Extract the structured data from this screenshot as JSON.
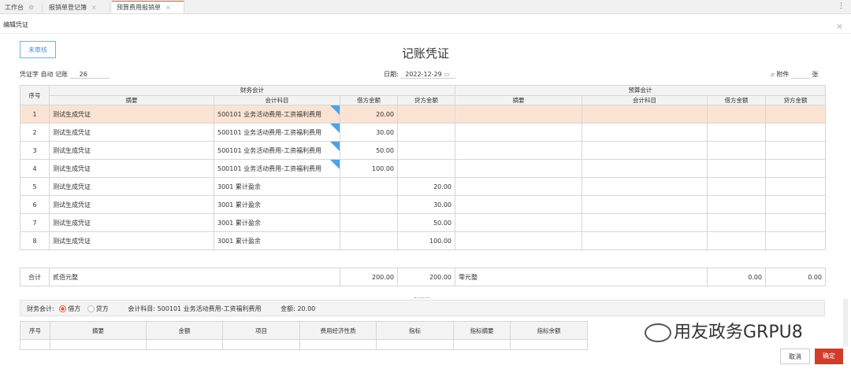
{
  "tabs": [
    {
      "label": "工作台"
    },
    {
      "label": "报销单登记簿"
    },
    {
      "label": "预算费用报销单"
    }
  ],
  "subtitle": "编辑凭证",
  "status_button": "未审核",
  "voucher_title": "记账凭证",
  "meta": {
    "voucher_type_label": "凭证字",
    "voucher_type_value": "自动",
    "book_label": "记账",
    "book_number": "26",
    "date_label": "日期:",
    "date_value": "2022-12-29",
    "attach_label": "附件",
    "attach_unit": "张"
  },
  "table": {
    "group_fin": "财务会计",
    "group_budget": "预算会计",
    "headers": {
      "index": "序号",
      "summary": "摘要",
      "subject": "会计科目",
      "debit": "借方金额",
      "credit": "贷方金额"
    },
    "rows": [
      {
        "idx": "1",
        "summary": "测试生成凭证",
        "subject": "500101 业务活动费用-工资福利费用",
        "debit": "20.00",
        "credit": ""
      },
      {
        "idx": "2",
        "summary": "测试生成凭证",
        "subject": "500101 业务活动费用-工资福利费用",
        "debit": "30.00",
        "credit": ""
      },
      {
        "idx": "3",
        "summary": "测试生成凭证",
        "subject": "500101 业务活动费用-工资福利费用",
        "debit": "50.00",
        "credit": ""
      },
      {
        "idx": "4",
        "summary": "测试生成凭证",
        "subject": "500101 业务活动费用-工资福利费用",
        "debit": "100.00",
        "credit": ""
      },
      {
        "idx": "5",
        "summary": "测试生成凭证",
        "subject": "3001 累计盈余",
        "debit": "",
        "credit": "20.00"
      },
      {
        "idx": "6",
        "summary": "测试生成凭证",
        "subject": "3001 累计盈余",
        "debit": "",
        "credit": "30.00"
      },
      {
        "idx": "7",
        "summary": "测试生成凭证",
        "subject": "3001 累计盈余",
        "debit": "",
        "credit": "50.00"
      },
      {
        "idx": "8",
        "summary": "测试生成凭证",
        "subject": "3001 累计盈余",
        "debit": "",
        "credit": "100.00"
      }
    ],
    "total": {
      "label": "合计",
      "fin_words": "贰佰元整",
      "fin_debit": "200.00",
      "fin_credit": "200.00",
      "budget_words": "零元整",
      "budget_debit": "0.00",
      "budget_credit": "0.00"
    }
  },
  "bottom": {
    "fin_label": "财务会计:",
    "debit_option": "借方",
    "credit_option": "贷方",
    "subject_text": "会计科目: 500101 业务活动费用-工资福利费用",
    "amount_text": "金额: 20.00"
  },
  "sub_headers": [
    "序号",
    "摘要",
    "金额",
    "项目",
    "费用经济性质",
    "指标",
    "指标摘要",
    "指标余额"
  ],
  "watermark": "用友政务GRPU8",
  "buttons": {
    "cancel": "取消",
    "ok": "确定"
  }
}
